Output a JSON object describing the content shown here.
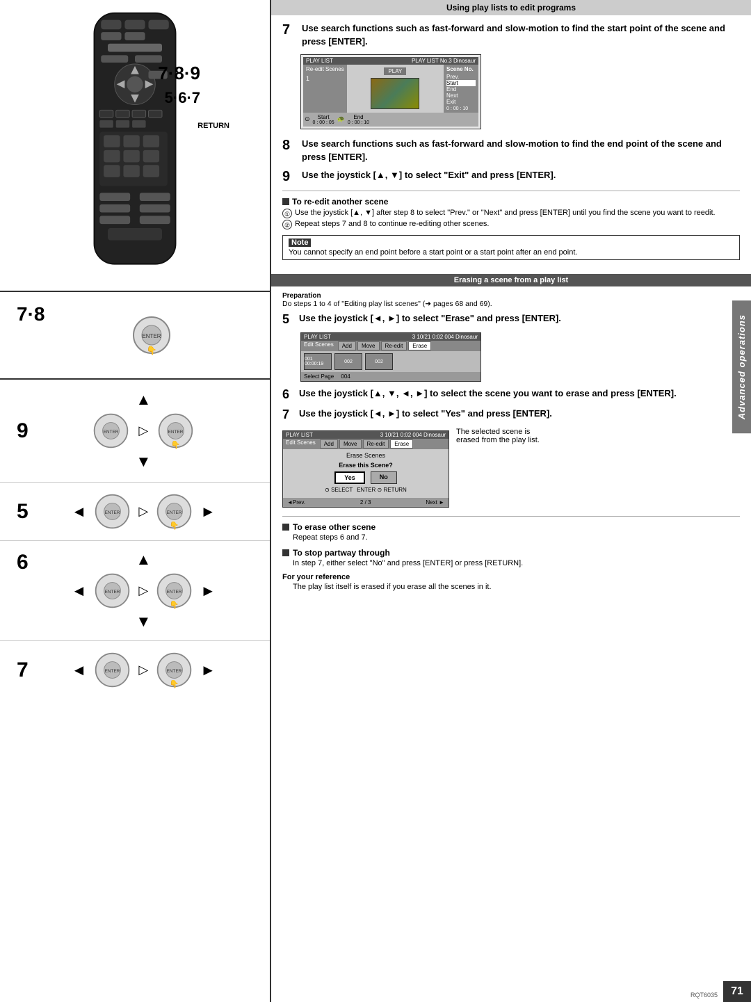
{
  "page": {
    "number": "71",
    "rqt_code": "RQT6035",
    "side_tab": "Advanced operations"
  },
  "left_panel": {
    "label_789": "7·8·9",
    "label_567": "5·6·7",
    "return_label": "RETURN",
    "steps": {
      "step78": {
        "num": "7·8"
      },
      "step9": {
        "num": "9"
      },
      "step5": {
        "num": "5"
      },
      "step6": {
        "num": "6"
      },
      "step7": {
        "num": "7"
      }
    }
  },
  "right_panel": {
    "top_section": {
      "header": "Using play lists to edit programs",
      "step7": {
        "num": "7",
        "text": "Use search functions such as fast-forward and slow-motion to find the start point of the scene and press [ENTER]."
      },
      "screen1": {
        "top_left": "PLAY LIST",
        "top_right": "PLAY LIST No.3 Dinosaur",
        "left_col_label": "Re-edit Scenes",
        "play_button": "PLAY",
        "scene_no": "Scene No.",
        "options": [
          "Prev.",
          "Start",
          "End",
          "Next",
          "Exit"
        ],
        "time1": "0 : 00 : 10",
        "start_label": "Start",
        "end_label": "End",
        "time2": "0 : 00 : 05",
        "time3": "0 : 00 : 10"
      },
      "step8": {
        "num": "8",
        "text": "Use search functions such as fast-forward and slow-motion to find the end point of the scene and press [ENTER]."
      },
      "step9": {
        "num": "9",
        "text": "Use the joystick [▲, ▼] to select \"Exit\" and press [ENTER]."
      },
      "re_edit_section": {
        "title": "To re-edit another scene",
        "item1": "Use the joystick [▲, ▼] after step 8 to select \"Prev.\" or \"Next\" and press [ENTER] until you find the scene you want to reedit.",
        "item2": "Repeat steps 7 and 8 to continue re-editing other scenes."
      },
      "note": {
        "label": "Note",
        "text": "You cannot specify an end point before a start point or a start point after an end point."
      }
    },
    "erase_section": {
      "header": "Erasing a scene from a play list",
      "prep_label": "Preparation",
      "prep_text": "Do steps 1 to 4 of \"Editing play list scenes\" (➜ pages 68 and 69).",
      "step5": {
        "num": "5",
        "text": "Use the joystick [◄, ►] to select \"Erase\" and press [ENTER]."
      },
      "screen2": {
        "top_left": "PLAY LIST",
        "top_right": "3 10/21 0:02 004 Dinosaur",
        "toolbar": [
          "Edit Scenes",
          "Add",
          "Move",
          "Re-edit",
          "Erase"
        ],
        "scenes": [
          "001 00:00:19",
          "002",
          "002"
        ],
        "select_page": "Select Page",
        "scene4": "004"
      },
      "step6": {
        "num": "6",
        "text": "Use the joystick [▲, ▼, ◄, ►] to select the scene you want to erase and press [ENTER]."
      },
      "step7": {
        "num": "7",
        "text": "Use the joystick [◄, ►] to select \"Yes\" and press [ENTER]."
      },
      "screen3_note": "The selected scene is erased from the play list.",
      "screen3": {
        "top_left": "PLAY LIST",
        "top_right": "3 10/21 0:02 004 Dinosaur",
        "toolbar": [
          "Edit Scenes",
          "Add",
          "Move",
          "Re-edit",
          "Erase"
        ],
        "middle_label": "Erase Scenes",
        "question": "Erase this Scene?",
        "yes": "Yes",
        "no": "No",
        "nav": [
          "◄Prev.",
          "2 / 3",
          "Next ►"
        ]
      },
      "bottom": {
        "erase_other": {
          "title": "To erase other scene",
          "text": "Repeat steps 6 and 7."
        },
        "stop_partway": {
          "title": "To stop partway through",
          "text": "In step 7, either select \"No\" and press [ENTER] or press [RETURN]."
        },
        "for_reference": {
          "label": "For your reference",
          "text": "The play list itself is erased if you erase all the scenes in it."
        }
      }
    }
  }
}
